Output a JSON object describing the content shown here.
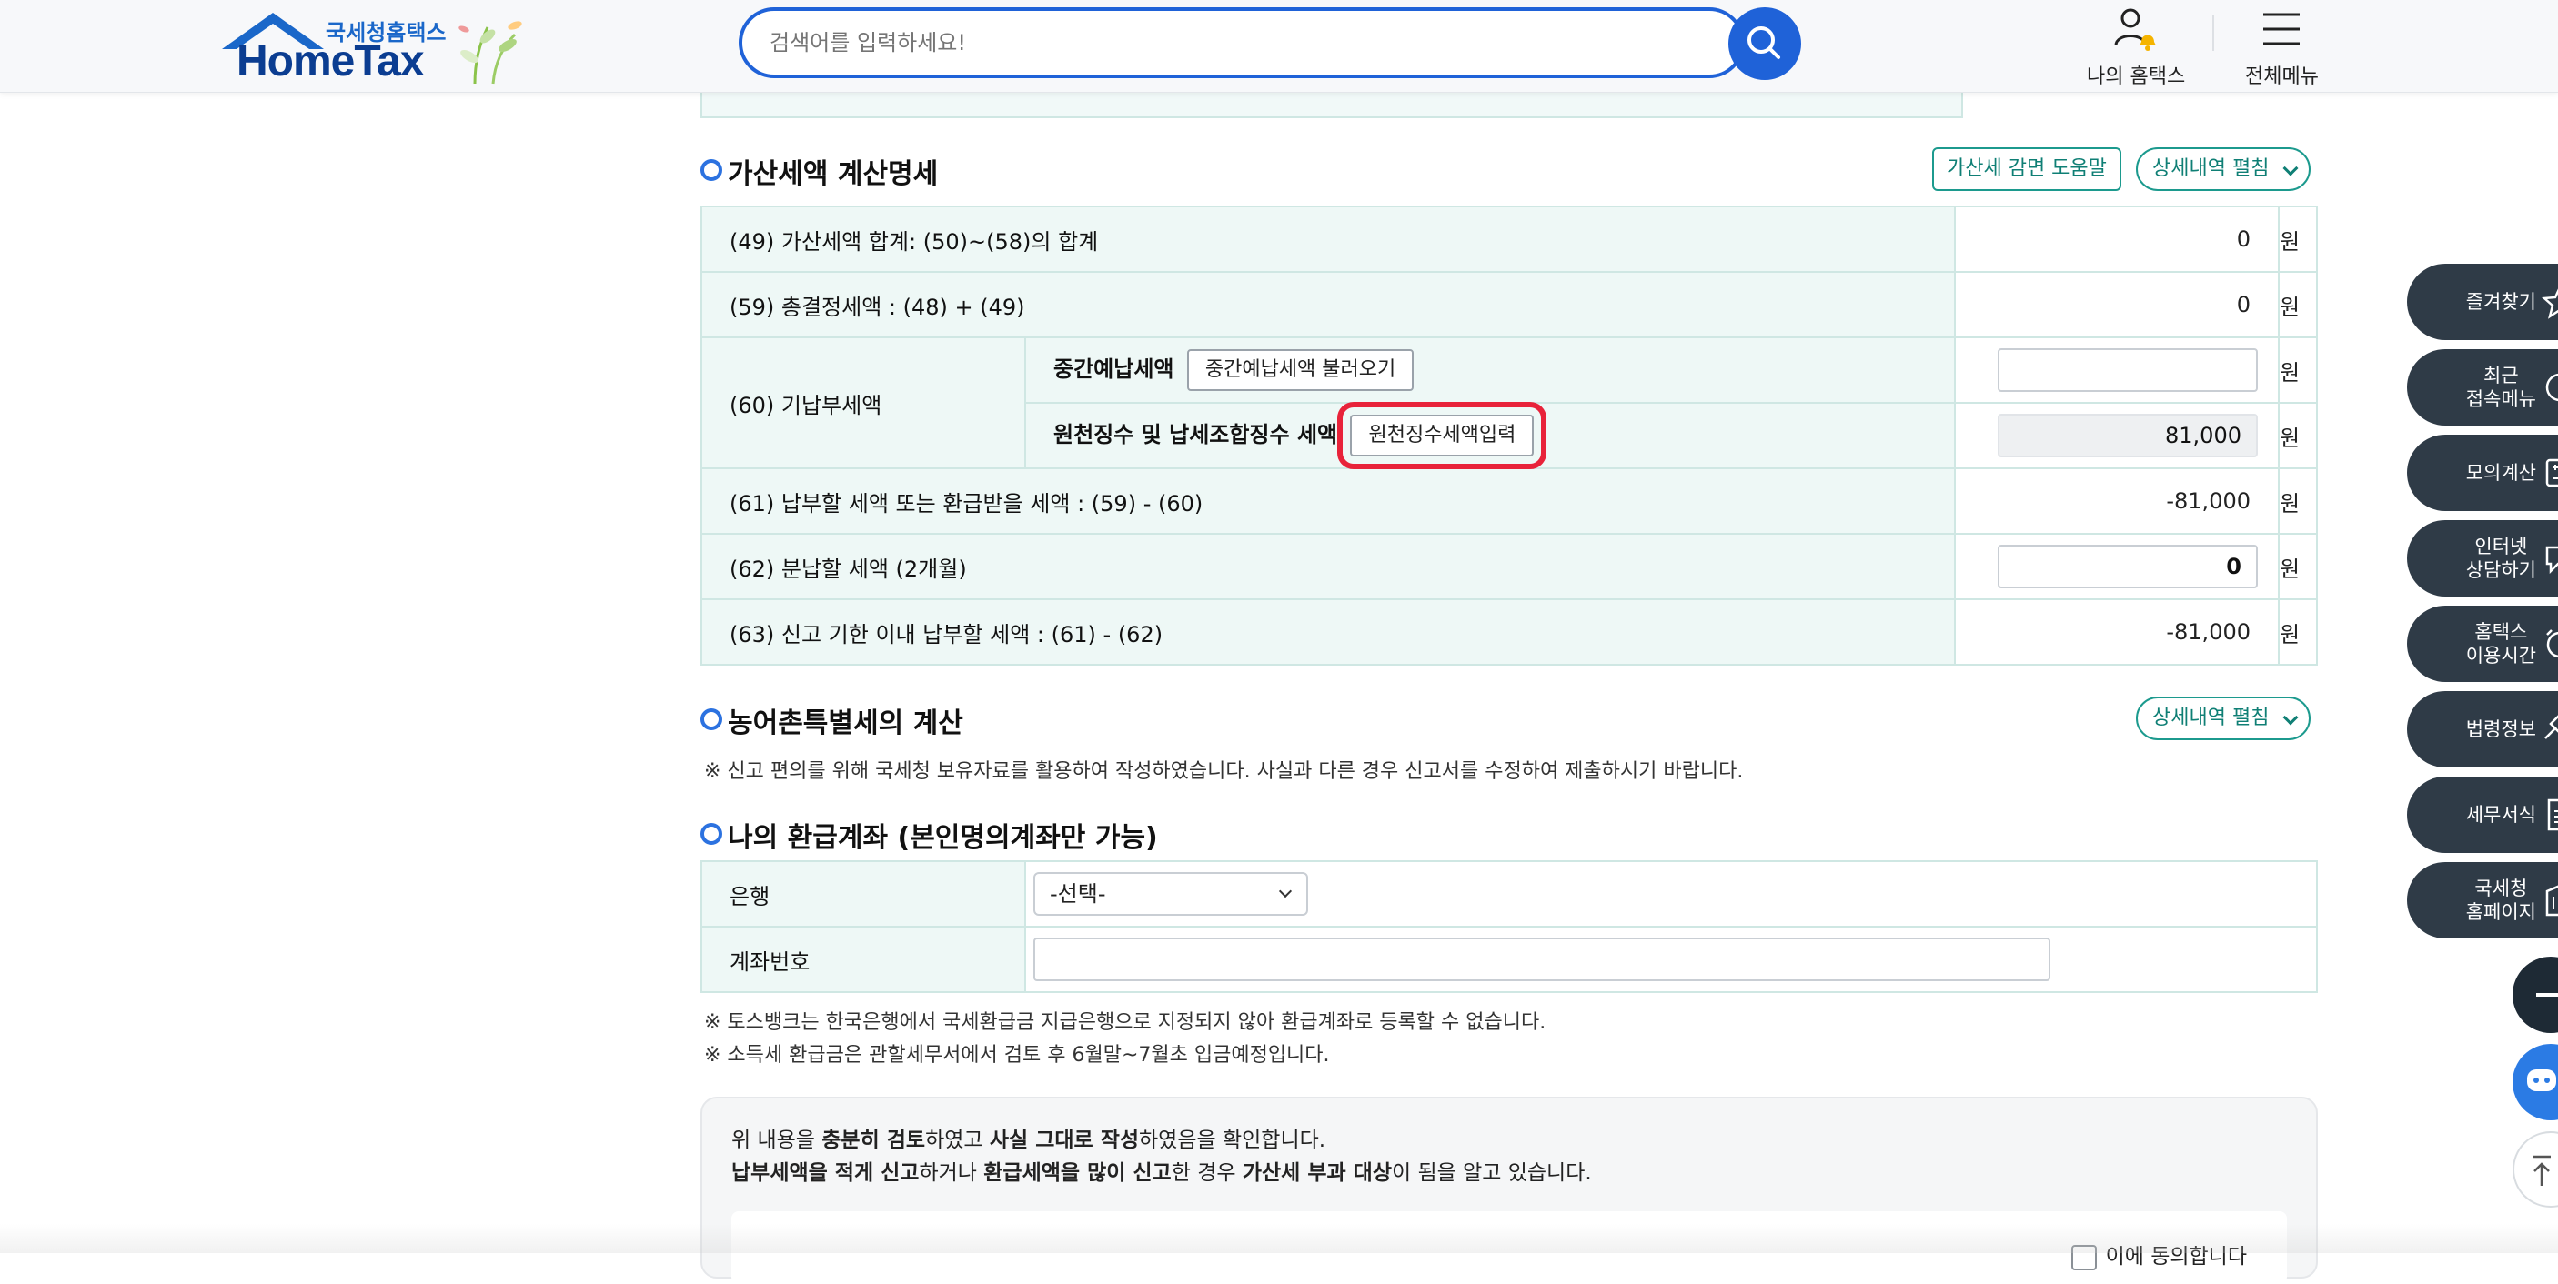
{
  "header": {
    "logo_sub": "국세청홈택스",
    "logo_main": "HomeTax",
    "search_placeholder": "검색어를 입력하세요!",
    "my_hometax": "나의 홈택스",
    "all_menu": "전체메뉴"
  },
  "penalty": {
    "title": "가산세액 계산명세",
    "help_btn": "가산세 감면 도움말",
    "expand_btn": "상세내역 펼침",
    "rows": {
      "r49_label": "(49) 가산세액 합계: (50)~(58)의 합계",
      "r49_value": "0",
      "r59_label": "(59) 총결정세액 : (48) + (49)",
      "r59_value": "0",
      "r60_label": "(60) 기납부세액",
      "r60a_label": "중간예납세액",
      "r60a_btn": "중간예납세액 불러오기",
      "r60a_value": "",
      "r60b_label": "원천징수 및 납세조합징수 세액",
      "r60b_btn": "원천징수세액입력",
      "r60b_value": "81,000",
      "r61_label": "(61) 납부할 세액 또는 환급받을 세액 : (59) - (60)",
      "r61_value": "-81,000",
      "r62_label": "(62) 분납할 세액 (2개월)",
      "r62_value": "0",
      "r63_label": "(63) 신고 기한 이내 납부할 세액 : (61) - (62)",
      "r63_value": "-81,000"
    },
    "unit": "원"
  },
  "rural": {
    "title": "농어촌특별세의 계산",
    "expand_btn": "상세내역 펼침",
    "note": "※ 신고 편의를 위해 국세청 보유자료를 활용하여 작성하였습니다. 사실과 다른 경우 신고서를 수정하여 제출하시기 바랍니다."
  },
  "refund": {
    "title": "나의 환급계좌 (본인명의계좌만 가능)",
    "bank_label": "은행",
    "bank_selected": "-선택-",
    "account_label": "계좌번호",
    "account_value": "",
    "note1": "※ 토스뱅크는 한국은행에서 국세환급금 지급은행으로 지정되지 않아 환급계좌로 등록할 수 없습니다.",
    "note2": "※ 소득세 환급금은 관할세무서에서 검토 후 6월말~7월초 입금예정입니다."
  },
  "confirm": {
    "line1_a": "위 내용을 ",
    "line1_b": "충분히 검토",
    "line1_c": "하였고 ",
    "line1_d": "사실 그대로 작성",
    "line1_e": "하였음을 확인합니다.",
    "line2_a": "납부세액을 적게 신고",
    "line2_b": "하거나 ",
    "line2_c": "환급세액을 많이 신고",
    "line2_d": "한 경우 ",
    "line2_e": "가산세 부과 대상",
    "line2_f": "이 됨을 알고 있습니다.",
    "agree": "이에 동의합니다"
  },
  "side_menu": {
    "favorites": "즐겨찾기",
    "recent": "최근\n접속메뉴",
    "mock_calc": "모의계산",
    "consult": "인터넷\n상담하기",
    "hours": "홈택스\n이용시간",
    "law": "법령정보",
    "tax_office": "세무서식",
    "nts_home": "국세청\n홈페이지"
  },
  "colors": {
    "brand_blue": "#1f62d8",
    "teal": "#1c9a8e",
    "highlight_red": "#e8233a",
    "side_dark": "#2f3b47"
  }
}
